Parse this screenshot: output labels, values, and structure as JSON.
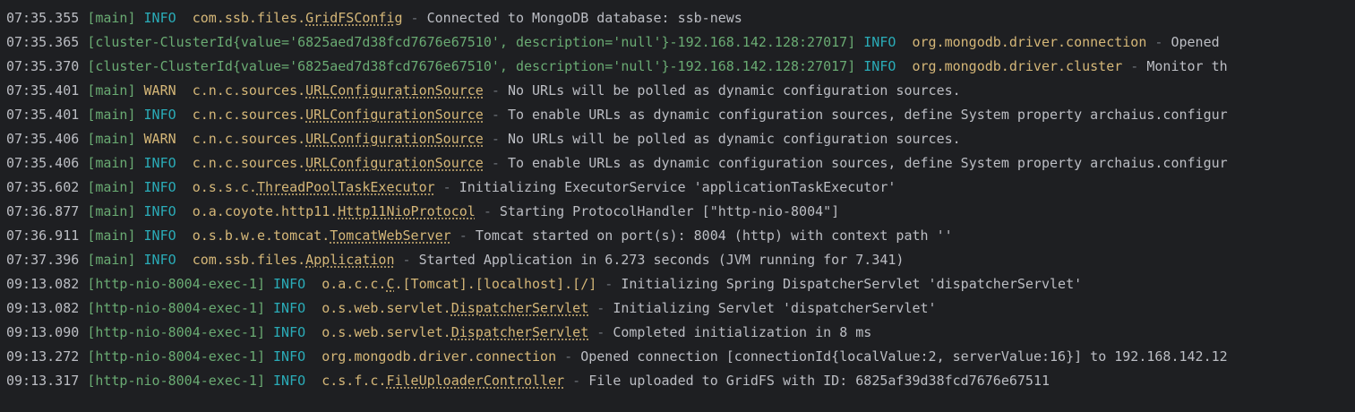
{
  "console": {
    "lines": [
      {
        "ts": "07:35.355",
        "thread": "[main]",
        "level": "INFO",
        "level_type": "info",
        "logger_prefix": "com.ssb.files.",
        "logger_class": "GridFSConfig",
        "sep": " - ",
        "message": "Connected to MongoDB database: ssb-news"
      },
      {
        "ts": "07:35.365",
        "thread": "[cluster-ClusterId{value='6825aed7d38fcd7676e67510', description='null'}-192.168.142.128:27017]",
        "level": "INFO",
        "level_type": "info",
        "logger_prefix": "org.mongodb.driver.connection",
        "logger_class": "",
        "sep": " - ",
        "message": "Opened"
      },
      {
        "ts": "07:35.370",
        "thread": "[cluster-ClusterId{value='6825aed7d38fcd7676e67510', description='null'}-192.168.142.128:27017]",
        "level": "INFO",
        "level_type": "info",
        "logger_prefix": "org.mongodb.driver.cluster",
        "logger_class": "",
        "sep": " - ",
        "message": "Monitor th"
      },
      {
        "ts": "07:35.401",
        "thread": "[main]",
        "level": "WARN",
        "level_type": "warn",
        "logger_prefix": "c.n.c.sources.",
        "logger_class": "URLConfigurationSource",
        "sep": " - ",
        "message": "No URLs will be polled as dynamic configuration sources."
      },
      {
        "ts": "07:35.401",
        "thread": "[main]",
        "level": "INFO",
        "level_type": "info",
        "logger_prefix": "c.n.c.sources.",
        "logger_class": "URLConfigurationSource",
        "sep": " - ",
        "message": "To enable URLs as dynamic configuration sources, define System property archaius.configur"
      },
      {
        "ts": "07:35.406",
        "thread": "[main]",
        "level": "WARN",
        "level_type": "warn",
        "logger_prefix": "c.n.c.sources.",
        "logger_class": "URLConfigurationSource",
        "sep": " - ",
        "message": "No URLs will be polled as dynamic configuration sources."
      },
      {
        "ts": "07:35.406",
        "thread": "[main]",
        "level": "INFO",
        "level_type": "info",
        "logger_prefix": "c.n.c.sources.",
        "logger_class": "URLConfigurationSource",
        "sep": " - ",
        "message": "To enable URLs as dynamic configuration sources, define System property archaius.configur"
      },
      {
        "ts": "07:35.602",
        "thread": "[main]",
        "level": "INFO",
        "level_type": "info",
        "logger_prefix": "o.s.s.c.",
        "logger_class": "ThreadPoolTaskExecutor",
        "sep": " - ",
        "message": "Initializing ExecutorService 'applicationTaskExecutor'"
      },
      {
        "ts": "07:36.877",
        "thread": "[main]",
        "level": "INFO",
        "level_type": "info",
        "logger_prefix": "o.a.coyote.http11.",
        "logger_class": "Http11NioProtocol",
        "sep": " - ",
        "message": "Starting ProtocolHandler [\"http-nio-8004\"]"
      },
      {
        "ts": "07:36.911",
        "thread": "[main]",
        "level": "INFO",
        "level_type": "info",
        "logger_prefix": "o.s.b.w.e.tomcat.",
        "logger_class": "TomcatWebServer",
        "sep": " - ",
        "message": "Tomcat started on port(s): 8004 (http) with context path ''"
      },
      {
        "ts": "07:37.396",
        "thread": "[main]",
        "level": "INFO",
        "level_type": "info",
        "logger_prefix": "com.ssb.files.",
        "logger_class": "Application",
        "sep": " - ",
        "message": "Started Application in 6.273 seconds (JVM running for 7.341)"
      },
      {
        "ts": "09:13.082",
        "thread": "[http-nio-8004-exec-1]",
        "level": "INFO",
        "level_type": "info",
        "logger_prefix": "o.a.c.c.",
        "logger_class": "C",
        "logger_suffix": ".[Tomcat].[localhost].[/]",
        "sep": " - ",
        "message": "Initializing Spring DispatcherServlet 'dispatcherServlet'"
      },
      {
        "ts": "09:13.082",
        "thread": "[http-nio-8004-exec-1]",
        "level": "INFO",
        "level_type": "info",
        "logger_prefix": "o.s.web.servlet.",
        "logger_class": "DispatcherServlet",
        "sep": " - ",
        "message": "Initializing Servlet 'dispatcherServlet'"
      },
      {
        "ts": "09:13.090",
        "thread": "[http-nio-8004-exec-1]",
        "level": "INFO",
        "level_type": "info",
        "logger_prefix": "o.s.web.servlet.",
        "logger_class": "DispatcherServlet",
        "sep": " - ",
        "message": "Completed initialization in 8 ms"
      },
      {
        "ts": "09:13.272",
        "thread": "[http-nio-8004-exec-1]",
        "level": "INFO",
        "level_type": "info",
        "logger_prefix": "org.mongodb.driver.connection",
        "logger_class": "",
        "sep": " - ",
        "message": "Opened connection [connectionId{localValue:2, serverValue:16}] to 192.168.142.12"
      },
      {
        "ts": "09:13.317",
        "thread": "[http-nio-8004-exec-1]",
        "level": "INFO",
        "level_type": "info",
        "logger_prefix": "c.s.f.c.",
        "logger_class": "FileUploaderController",
        "sep": " - ",
        "message": "File uploaded to GridFS with ID: 6825af39d38fcd7676e67511"
      }
    ]
  },
  "colors": {
    "background": "#1e1f22",
    "timestamp": "#bcbec4",
    "thread": "#6aab73",
    "info": "#2aacb8",
    "warn": "#d5b778",
    "logger": "#d5b778",
    "separator": "#6f737a"
  }
}
